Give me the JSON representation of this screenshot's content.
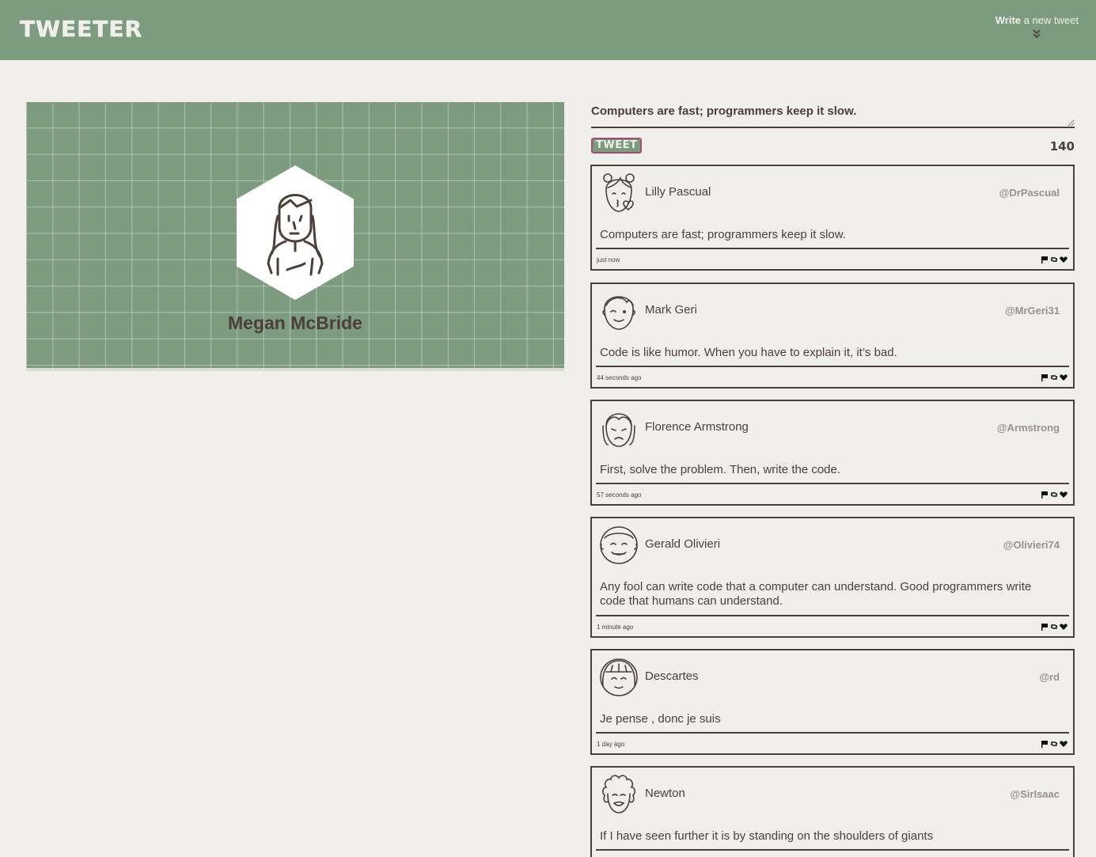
{
  "nav": {
    "logo": "TWEETER",
    "compose_bold": "Write",
    "compose_rest": " a new tweet"
  },
  "profile": {
    "name": "Megan McBride"
  },
  "compose": {
    "textarea_value": "Computers are fast; programmers keep it slow.",
    "tweet_button": "TWEET",
    "counter": "140"
  },
  "tweets": [
    {
      "name": "Lilly Pascual",
      "handle": "@DrPascual",
      "text": "Computers are fast; programmers keep it slow.",
      "time": "just now",
      "avatar": "woman-buns-avatar"
    },
    {
      "name": "Mark Geri",
      "handle": "@MrGeri31",
      "text": "Code is like humor. When you have to explain it, it’s bad.",
      "time": "44 seconds ago",
      "avatar": "man-wink-avatar"
    },
    {
      "name": "Florence Armstrong",
      "handle": "@Armstrong",
      "text": "First, solve the problem. Then, write the code.",
      "time": "57 seconds ago",
      "avatar": "woman-sad-avatar"
    },
    {
      "name": "Gerald Olivieri",
      "handle": "@Olivieri74",
      "text": "Any fool can write code that a computer can understand. Good programmers write code that humans can understand.",
      "time": "1 minute ago",
      "avatar": "man-smile-avatar"
    },
    {
      "name": "Descartes",
      "handle": "@rd",
      "text": "Je pense , donc je suis",
      "time": "1 day ago",
      "avatar": "bob-hair-avatar"
    },
    {
      "name": "Newton",
      "handle": "@SirIsaac",
      "text": "If I have seen further it is by standing on the shoulders of giants",
      "time": "",
      "avatar": "curly-hair-avatar"
    }
  ]
}
